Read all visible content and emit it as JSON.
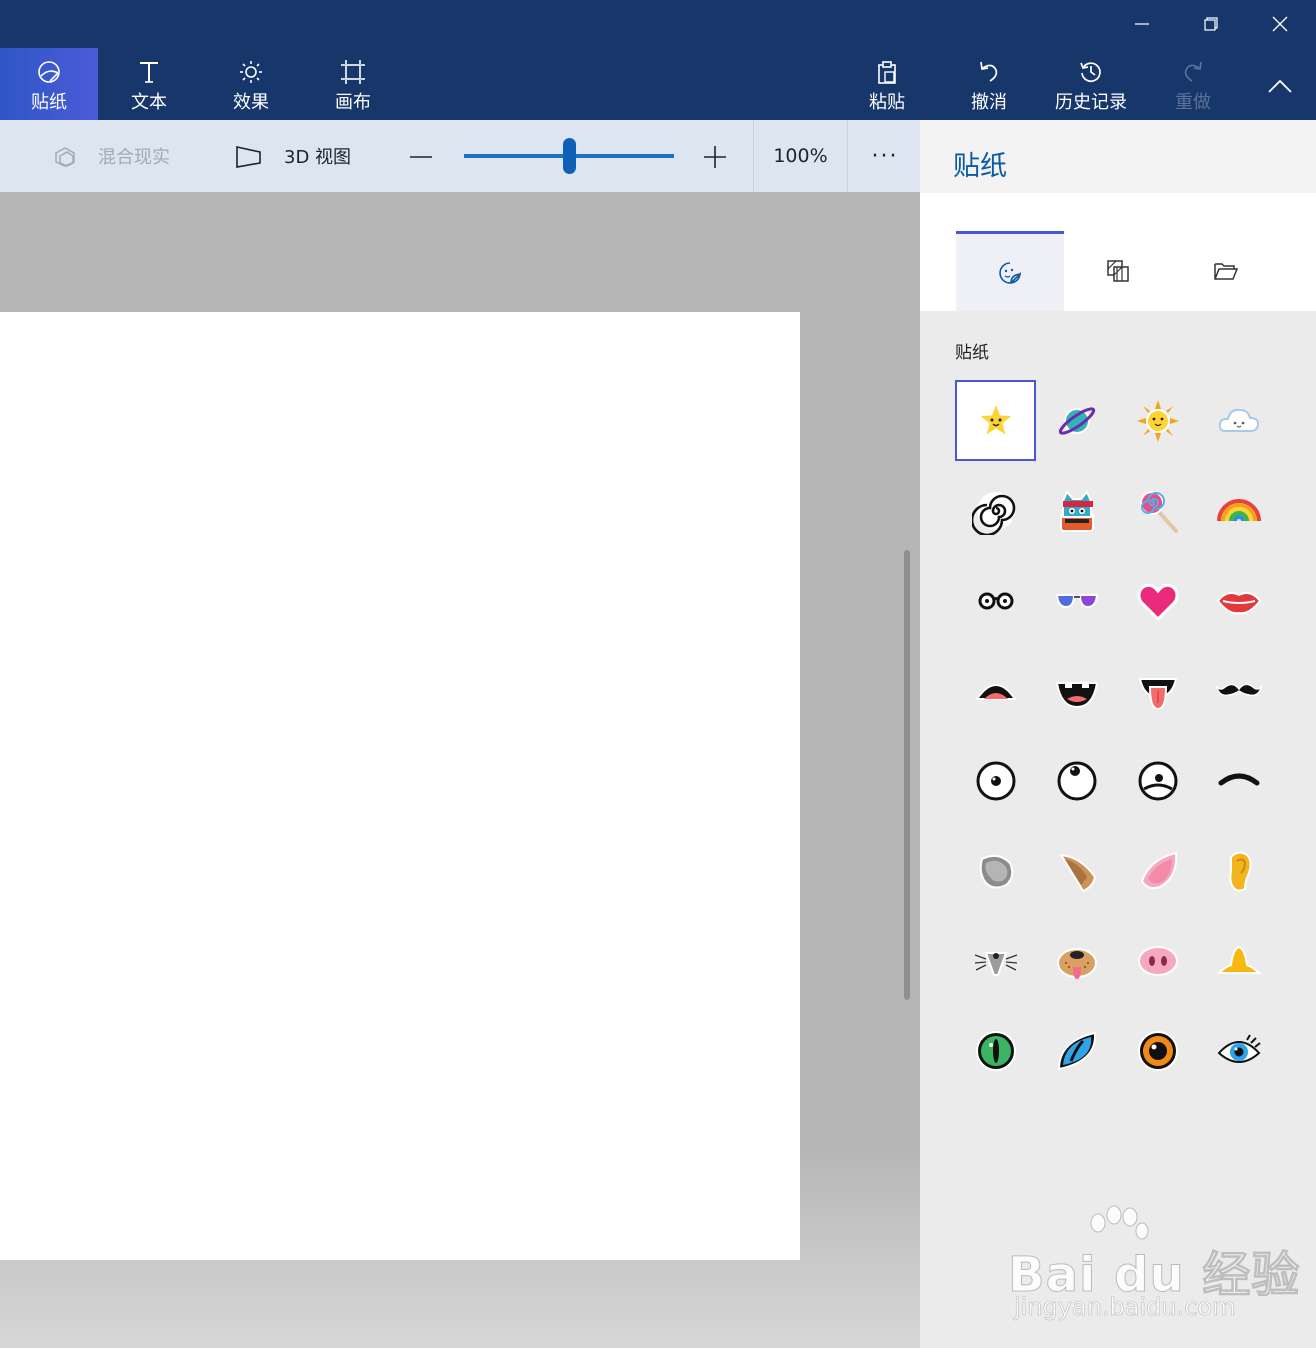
{
  "ribbon": {
    "tools": [
      {
        "label": "贴纸",
        "icon": "sticker-icon",
        "active": true
      },
      {
        "label": "文本",
        "icon": "text-icon"
      },
      {
        "label": "效果",
        "icon": "effects-icon"
      },
      {
        "label": "画布",
        "icon": "canvas-icon"
      }
    ],
    "actions": [
      {
        "label": "粘贴",
        "icon": "paste-icon"
      },
      {
        "label": "撤消",
        "icon": "undo-icon"
      },
      {
        "label": "历史记录",
        "icon": "history-icon"
      },
      {
        "label": "重做",
        "icon": "redo-icon",
        "disabled": true
      }
    ],
    "collapse_icon": "chevron-up-icon"
  },
  "window_controls": [
    "minimize-icon",
    "restore-icon",
    "close-icon"
  ],
  "subtoolbar": {
    "mixed_reality_label": "混合现实",
    "view3d_label": "3D 视图",
    "zoom_value": "100%",
    "zoom_slider_fraction": 0.5,
    "more_label": "···"
  },
  "panel": {
    "title": "贴纸",
    "tabs": [
      "sticker-tab-icon",
      "texture-tab-icon",
      "custom-sticker-folder-icon"
    ],
    "section_label": "贴纸",
    "stickers": [
      "star-face",
      "planet",
      "sun",
      "cloud",
      "spiral",
      "ninja-cat",
      "lollipop",
      "rainbow",
      "glasses",
      "sunglasses",
      "heart",
      "lips",
      "open-mouth",
      "teeth-mouth",
      "tongue-mouth",
      "mustache",
      "eye-center",
      "eye-up",
      "eye-worried",
      "eyebrow",
      "mouse-ear",
      "dog-ear",
      "pig-ear",
      "human-ear",
      "mouse-nose",
      "dog-nose",
      "pig-nose",
      "yellow-nose",
      "cat-eye-green",
      "cat-eye-blue",
      "eye-orange",
      "lash-eye-blue"
    ]
  },
  "watermark": {
    "brand": "Bai du 经验",
    "url": "jingyan.baidu.com"
  }
}
